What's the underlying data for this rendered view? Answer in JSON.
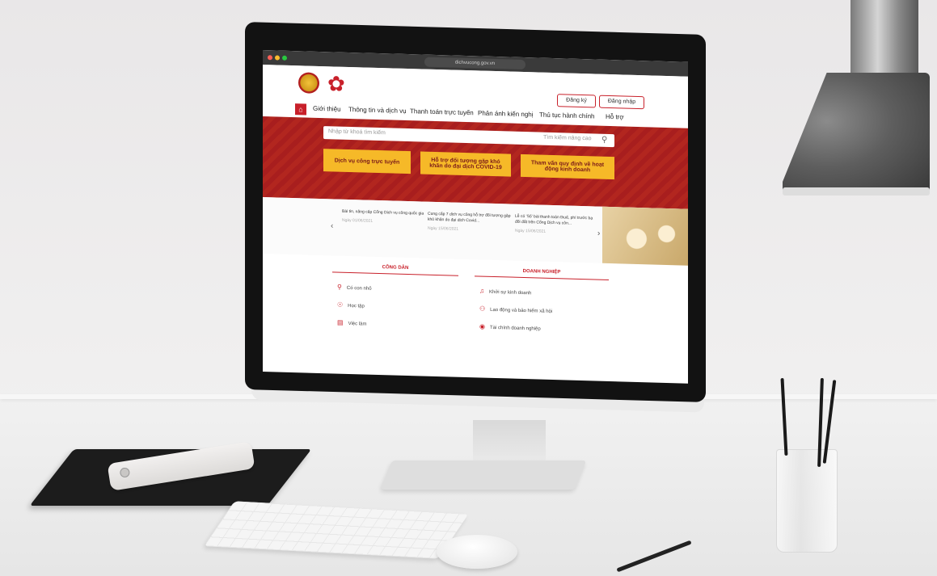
{
  "browser": {
    "url": "dichvucong.gov.vn"
  },
  "site": {
    "register_label": "Đăng ký",
    "login_label": "Đăng nhập",
    "nav": [
      "Giới thiệu",
      "Thông tin và dịch vụ",
      "Thanh toán trực tuyến",
      "Phản ánh kiến nghị",
      "Thủ tục hành chính",
      "Hỗ trợ"
    ]
  },
  "hero": {
    "search_placeholder": "Nhập từ khoá tìm kiếm",
    "search_advanced": "Tìm kiếm nâng cao",
    "buttons": [
      "Dịch vụ công trực tuyến",
      "Hỗ trợ đối tượng gặp khó khăn do đại dịch COVID-19",
      "Tham vấn quy định về hoạt động kinh doanh"
    ]
  },
  "news": [
    {
      "title": "Bài tin, nâng cấp Cổng Dịch vụ công quốc gia",
      "date": "Ngày 01/06/2021"
    },
    {
      "title": "Cung cấp 7 dịch vụ công hỗ trợ đối tượng gặp khó khăn do đại dịch Covid...",
      "date": "Ngày 15/06/2021"
    },
    {
      "title": "Lễ có 'Số' bài thanh toán thuế, phí trước bạ đối đất trên Cổng Dịch vụ côn...",
      "date": "Ngày 15/06/2021"
    }
  ],
  "sections": {
    "citizen": {
      "title": "CÔNG DÂN",
      "items": [
        "Có con nhỏ",
        "Học tập",
        "Việc làm"
      ]
    },
    "business": {
      "title": "DOANH NGHIỆP",
      "items": [
        "Khởi sự kinh doanh",
        "Lao động và bảo hiểm xã hội",
        "Tài chính doanh nghiệp"
      ]
    }
  },
  "colors": {
    "brand_red": "#c8202a",
    "accent_yellow": "#f6b928"
  }
}
